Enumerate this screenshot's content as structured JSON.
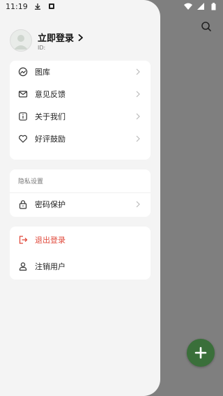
{
  "status_bar": {
    "time": "11:19"
  },
  "profile": {
    "title": "立即登录",
    "id_label": "ID:"
  },
  "menu_main": [
    {
      "label": "图库",
      "icon": "gallery-icon"
    },
    {
      "label": "意见反馈",
      "icon": "mail-icon"
    },
    {
      "label": "关于我们",
      "icon": "info-icon"
    },
    {
      "label": "好评鼓励",
      "icon": "heart-icon"
    }
  ],
  "privacy": {
    "section_title": "隐私设置",
    "items": [
      {
        "label": "密码保护",
        "icon": "lock-icon"
      }
    ]
  },
  "account": {
    "logout_label": "退出登录",
    "delete_label": "注销用户"
  },
  "colors": {
    "logout": "#e0493b",
    "fab": "#3a6f3a",
    "overlay": "#7f7f7f",
    "drawer": "#f4f4f4"
  }
}
